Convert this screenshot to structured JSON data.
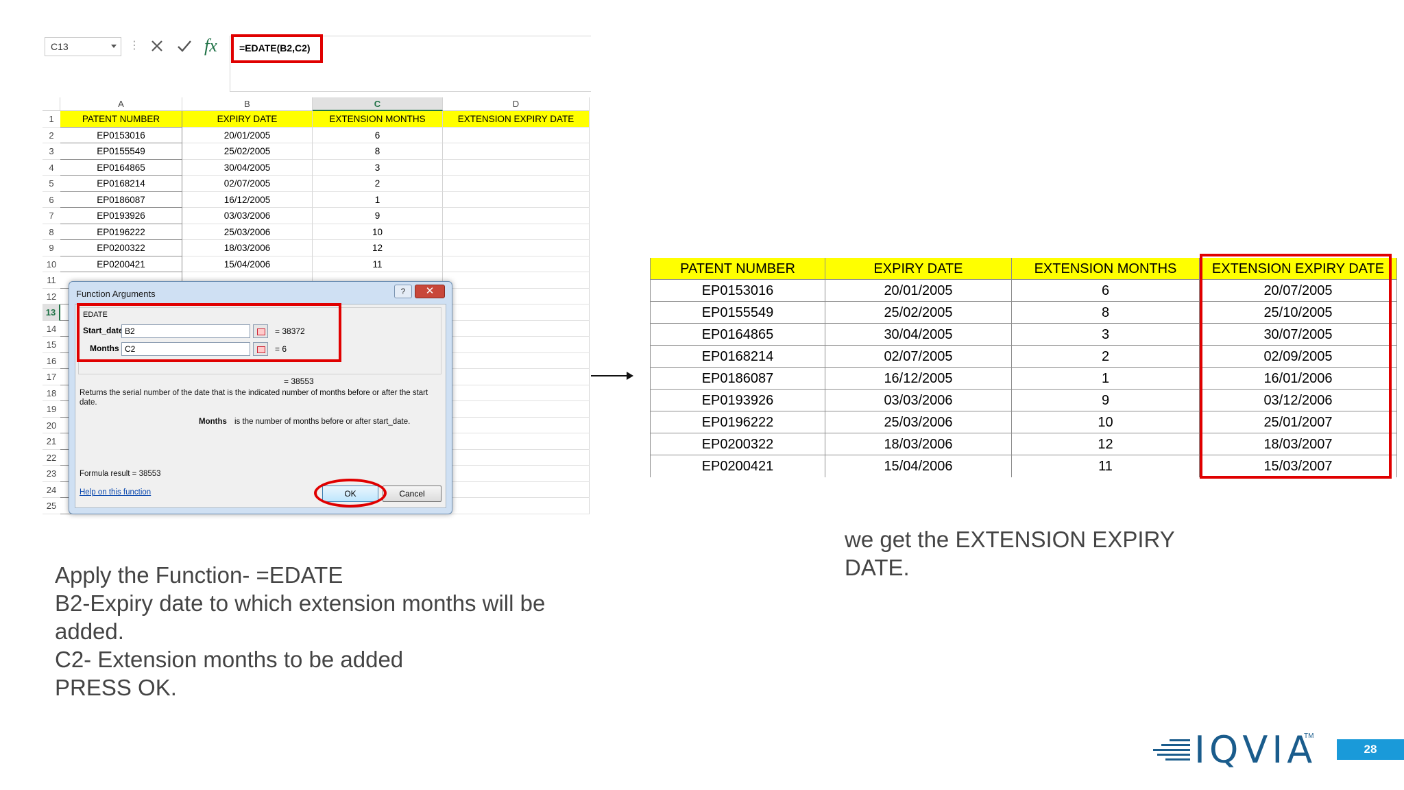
{
  "excel": {
    "name_box": "C13",
    "formula": "=EDATE(B2,C2)",
    "columns": [
      "A",
      "B",
      "C",
      "D"
    ],
    "header_row": [
      "PATENT NUMBER",
      "EXPIRY DATE",
      "EXTENSION MONTHS",
      "EXTENSION EXPIRY DATE"
    ],
    "row_numbers": [
      "1",
      "2",
      "3",
      "4",
      "5",
      "6",
      "7",
      "8",
      "9",
      "10",
      "11",
      "12",
      "13",
      "14",
      "15",
      "16",
      "17",
      "18",
      "19",
      "20",
      "21",
      "22",
      "23",
      "24",
      "25"
    ],
    "rows": [
      [
        "EP0153016",
        "20/01/2005",
        "6",
        ""
      ],
      [
        "EP0155549",
        "25/02/2005",
        "8",
        ""
      ],
      [
        "EP0164865",
        "30/04/2005",
        "3",
        ""
      ],
      [
        "EP0168214",
        "02/07/2005",
        "2",
        ""
      ],
      [
        "EP0186087",
        "16/12/2005",
        "1",
        ""
      ],
      [
        "EP0193926",
        "03/03/2006",
        "9",
        ""
      ],
      [
        "EP0196222",
        "25/03/2006",
        "10",
        ""
      ],
      [
        "EP0200322",
        "18/03/2006",
        "12",
        ""
      ],
      [
        "EP0200421",
        "15/04/2006",
        "11",
        ""
      ]
    ]
  },
  "dialog": {
    "title": "Function Arguments",
    "help_btn": "?",
    "close_btn": "✕",
    "function_name": "EDATE",
    "start_date_label": "Start_date",
    "start_date_value": "B2",
    "start_date_result": "=  38372",
    "months_label": "Months",
    "months_value": "C2",
    "months_result": "=  6",
    "total_result": "=  38553",
    "description": "Returns the serial number of the date that is the indicated number of months before or after the start date.",
    "arg_help_label": "Months",
    "arg_help_text": "is the number of months before or after start_date.",
    "formula_result": "Formula result =   38553",
    "help_link": "Help on this function",
    "ok_label": "OK",
    "cancel_label": "Cancel"
  },
  "left_text": [
    "Apply the Function- =EDATE",
    "B2-Expiry date to which extension months will be added.",
    "C2- Extension months to be added",
    "PRESS OK."
  ],
  "right_text": "we get the EXTENSION EXPIRY DATE.",
  "result_table": {
    "headers": [
      "PATENT NUMBER",
      "EXPIRY DATE",
      "EXTENSION MONTHS",
      "EXTENSION EXPIRY DATE"
    ],
    "rows": [
      [
        "EP0153016",
        "20/01/2005",
        "6",
        "20/07/2005"
      ],
      [
        "EP0155549",
        "25/02/2005",
        "8",
        "25/10/2005"
      ],
      [
        "EP0164865",
        "30/04/2005",
        "3",
        "30/07/2005"
      ],
      [
        "EP0168214",
        "02/07/2005",
        "2",
        "02/09/2005"
      ],
      [
        "EP0186087",
        "16/12/2005",
        "1",
        "16/01/2006"
      ],
      [
        "EP0193926",
        "03/03/2006",
        "9",
        "03/12/2006"
      ],
      [
        "EP0196222",
        "25/03/2006",
        "10",
        "25/01/2007"
      ],
      [
        "EP0200322",
        "18/03/2006",
        "12",
        "18/03/2007"
      ],
      [
        "EP0200421",
        "15/04/2006",
        "11",
        "15/03/2007"
      ]
    ]
  },
  "footer": {
    "logo": "IQVIA",
    "trademark": "TM",
    "page_number": "28"
  },
  "colors": {
    "highlight_yellow": "#ffff00",
    "annotation_red": "#e00000",
    "iqvia_blue": "#1a5c8c",
    "page_badge": "#1a9ad9"
  }
}
